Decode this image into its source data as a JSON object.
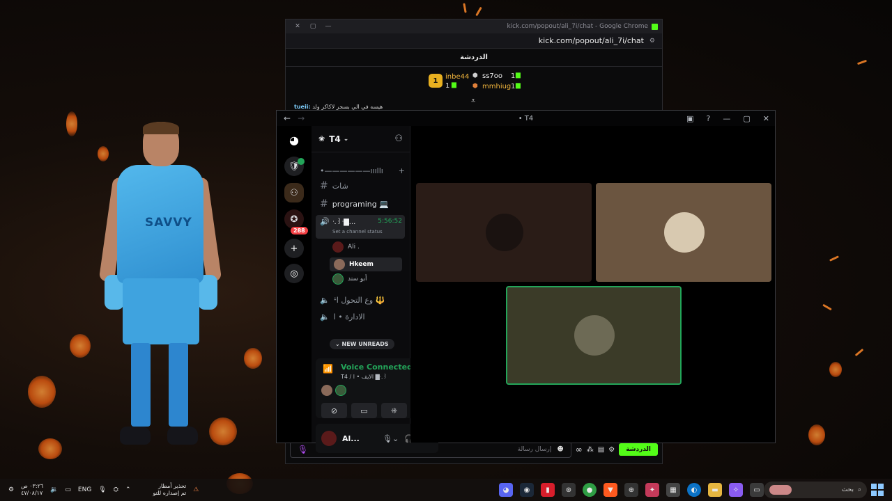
{
  "chrome": {
    "title": "kick.com/popout/ali_7i/chat - Google Chrome",
    "url": "kick.com/popout/ali_7i/chat",
    "chat_header": "الدردشة",
    "leaderboard": [
      {
        "name": "inbe44",
        "count": "1",
        "rank": "1"
      },
      {
        "name": "ss7oo",
        "count": "1"
      },
      {
        "name": "mmhiug",
        "count": "1"
      }
    ],
    "chat_line_user": "tueii:",
    "chat_line_text": "هيسه في الي بسجر لاكاكر ولد",
    "input_placeholder": "إرسال رسالة",
    "chat_button": "الدردشة",
    "accent": "#53fc18"
  },
  "discord": {
    "window_title": "T4",
    "server_name": "T4",
    "channels": {
      "category": "•——————ıııllı",
      "text1": "شات",
      "text2": "programing 💻",
      "voice_active": "ᐧ.꒱ᐧ▇... ",
      "voice_timer": "5:56:52",
      "voice_status": "Set a channel status",
      "users": [
        "Ali .",
        "Hkeem",
        "أبو سند"
      ],
      "voice2": "ꜜوع التحول ا 🔱",
      "voice3": "الادارة • ا"
    },
    "new_unreads": "NEW UNREADS",
    "badge_count": "288",
    "voice_panel": {
      "status": "Voice Connected",
      "sub": "T4 / الايف • ا ▇ᐧ.꒱"
    },
    "user_panel": {
      "name": "Al..."
    }
  },
  "taskbar": {
    "time": "٠٣:٢٦ ص",
    "date": "٤٧/٠٨/١٧",
    "lang": "ENG",
    "weather_title": "تحذير أمطار",
    "weather_sub": "تم إصداره للتو",
    "search": "بحث"
  }
}
